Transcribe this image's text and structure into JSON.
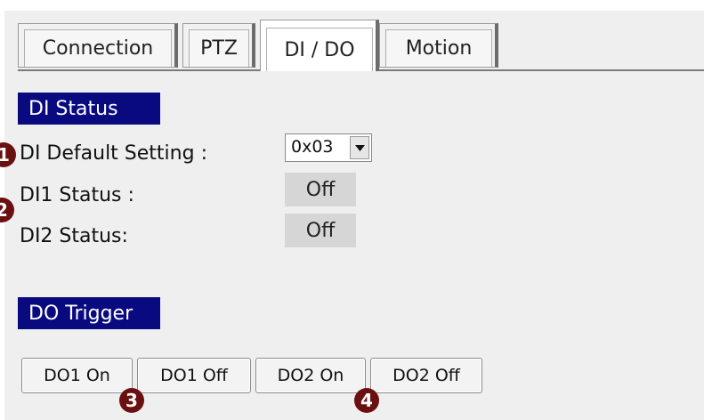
{
  "tabs": [
    {
      "label": "Connection"
    },
    {
      "label": "PTZ"
    },
    {
      "label": "DI / DO"
    },
    {
      "label": "Motion"
    }
  ],
  "di_status": {
    "header": "DI Status",
    "default_setting_label": "DI Default Setting :",
    "default_setting_value": "0x03",
    "di1_label": "DI1 Status :",
    "di1_value": "Off",
    "di2_label": "DI2 Status:",
    "di2_value": "Off"
  },
  "do_trigger": {
    "header": "DO Trigger",
    "buttons": [
      {
        "label": "DO1 On"
      },
      {
        "label": "DO1 Off"
      },
      {
        "label": "DO2 On"
      },
      {
        "label": "DO2 Off"
      }
    ]
  },
  "badges": [
    "1",
    "2",
    "3",
    "4"
  ],
  "colors": {
    "header_bg": "#0a0a80",
    "badge_bg": "#6b1010",
    "panel_bg": "#efefef"
  }
}
